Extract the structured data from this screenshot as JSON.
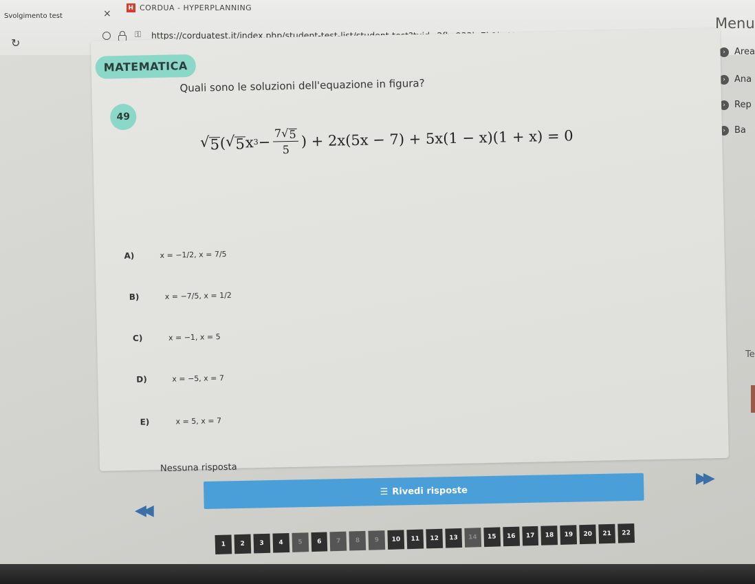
{
  "browser": {
    "inactive_tab": "Svolgimento test",
    "close_glyph": "×",
    "active_tab": "CORDUA - HYPERPLANNING",
    "favicon_letter": "H",
    "url": "https://corduatest.it/index.php/student-test-list/student-test?tuid=2fbc933b-7b1b-4946-ab55-4"
  },
  "menu": {
    "label": "Menu",
    "items": [
      {
        "label": "Area"
      },
      {
        "label": "Ana"
      },
      {
        "label": "Rep"
      },
      {
        "label": "Ba"
      }
    ],
    "clipped_text": "Te"
  },
  "question": {
    "subject": "MATEMATICA",
    "number": "49",
    "text": "Quali sono le soluzioni dell'equazione in figura?",
    "equation": {
      "root": "5",
      "inner_coef_root": "5",
      "inner_var": "x",
      "inner_exp": "3",
      "minus": " − ",
      "frac_num_coef": "7",
      "frac_num_root": "5",
      "frac_den": "5",
      "rest": ") + 2x(5x − 7) + 5x(1 − x)(1 + x) = 0"
    },
    "options": [
      {
        "letter": "A)",
        "value": "x = −1/2, x = 7/5"
      },
      {
        "letter": "B)",
        "value": "x = −7/5, x = 1/2"
      },
      {
        "letter": "C)",
        "value": "x = −1, x = 5"
      },
      {
        "letter": "D)",
        "value": "x = −5, x = 7"
      },
      {
        "letter": "E)",
        "value": "x = 5, x = 7"
      }
    ],
    "no_answer": "Nessuna risposta"
  },
  "navigation": {
    "review_label": "Rivedi risposte",
    "pages": [
      "1",
      "2",
      "3",
      "4",
      "5",
      "6",
      "7",
      "8",
      "9",
      "10",
      "11",
      "12",
      "13",
      "14",
      "15",
      "16",
      "17",
      "18",
      "19",
      "20",
      "21",
      "22"
    ],
    "dim_pages": [
      "5",
      "7",
      "8",
      "9",
      "14"
    ]
  }
}
